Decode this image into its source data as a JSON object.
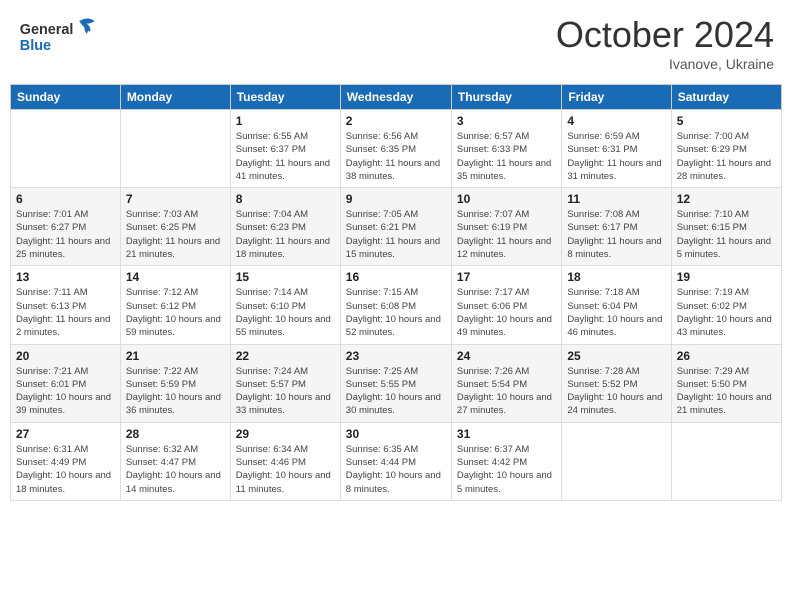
{
  "header": {
    "logo_line1": "General",
    "logo_line2": "Blue",
    "month": "October 2024",
    "location": "Ivanove, Ukraine"
  },
  "weekdays": [
    "Sunday",
    "Monday",
    "Tuesday",
    "Wednesday",
    "Thursday",
    "Friday",
    "Saturday"
  ],
  "weeks": [
    [
      {
        "day": "",
        "info": ""
      },
      {
        "day": "",
        "info": ""
      },
      {
        "day": "1",
        "info": "Sunrise: 6:55 AM\nSunset: 6:37 PM\nDaylight: 11 hours and 41 minutes."
      },
      {
        "day": "2",
        "info": "Sunrise: 6:56 AM\nSunset: 6:35 PM\nDaylight: 11 hours and 38 minutes."
      },
      {
        "day": "3",
        "info": "Sunrise: 6:57 AM\nSunset: 6:33 PM\nDaylight: 11 hours and 35 minutes."
      },
      {
        "day": "4",
        "info": "Sunrise: 6:59 AM\nSunset: 6:31 PM\nDaylight: 11 hours and 31 minutes."
      },
      {
        "day": "5",
        "info": "Sunrise: 7:00 AM\nSunset: 6:29 PM\nDaylight: 11 hours and 28 minutes."
      }
    ],
    [
      {
        "day": "6",
        "info": "Sunrise: 7:01 AM\nSunset: 6:27 PM\nDaylight: 11 hours and 25 minutes."
      },
      {
        "day": "7",
        "info": "Sunrise: 7:03 AM\nSunset: 6:25 PM\nDaylight: 11 hours and 21 minutes."
      },
      {
        "day": "8",
        "info": "Sunrise: 7:04 AM\nSunset: 6:23 PM\nDaylight: 11 hours and 18 minutes."
      },
      {
        "day": "9",
        "info": "Sunrise: 7:05 AM\nSunset: 6:21 PM\nDaylight: 11 hours and 15 minutes."
      },
      {
        "day": "10",
        "info": "Sunrise: 7:07 AM\nSunset: 6:19 PM\nDaylight: 11 hours and 12 minutes."
      },
      {
        "day": "11",
        "info": "Sunrise: 7:08 AM\nSunset: 6:17 PM\nDaylight: 11 hours and 8 minutes."
      },
      {
        "day": "12",
        "info": "Sunrise: 7:10 AM\nSunset: 6:15 PM\nDaylight: 11 hours and 5 minutes."
      }
    ],
    [
      {
        "day": "13",
        "info": "Sunrise: 7:11 AM\nSunset: 6:13 PM\nDaylight: 11 hours and 2 minutes."
      },
      {
        "day": "14",
        "info": "Sunrise: 7:12 AM\nSunset: 6:12 PM\nDaylight: 10 hours and 59 minutes."
      },
      {
        "day": "15",
        "info": "Sunrise: 7:14 AM\nSunset: 6:10 PM\nDaylight: 10 hours and 55 minutes."
      },
      {
        "day": "16",
        "info": "Sunrise: 7:15 AM\nSunset: 6:08 PM\nDaylight: 10 hours and 52 minutes."
      },
      {
        "day": "17",
        "info": "Sunrise: 7:17 AM\nSunset: 6:06 PM\nDaylight: 10 hours and 49 minutes."
      },
      {
        "day": "18",
        "info": "Sunrise: 7:18 AM\nSunset: 6:04 PM\nDaylight: 10 hours and 46 minutes."
      },
      {
        "day": "19",
        "info": "Sunrise: 7:19 AM\nSunset: 6:02 PM\nDaylight: 10 hours and 43 minutes."
      }
    ],
    [
      {
        "day": "20",
        "info": "Sunrise: 7:21 AM\nSunset: 6:01 PM\nDaylight: 10 hours and 39 minutes."
      },
      {
        "day": "21",
        "info": "Sunrise: 7:22 AM\nSunset: 5:59 PM\nDaylight: 10 hours and 36 minutes."
      },
      {
        "day": "22",
        "info": "Sunrise: 7:24 AM\nSunset: 5:57 PM\nDaylight: 10 hours and 33 minutes."
      },
      {
        "day": "23",
        "info": "Sunrise: 7:25 AM\nSunset: 5:55 PM\nDaylight: 10 hours and 30 minutes."
      },
      {
        "day": "24",
        "info": "Sunrise: 7:26 AM\nSunset: 5:54 PM\nDaylight: 10 hours and 27 minutes."
      },
      {
        "day": "25",
        "info": "Sunrise: 7:28 AM\nSunset: 5:52 PM\nDaylight: 10 hours and 24 minutes."
      },
      {
        "day": "26",
        "info": "Sunrise: 7:29 AM\nSunset: 5:50 PM\nDaylight: 10 hours and 21 minutes."
      }
    ],
    [
      {
        "day": "27",
        "info": "Sunrise: 6:31 AM\nSunset: 4:49 PM\nDaylight: 10 hours and 18 minutes."
      },
      {
        "day": "28",
        "info": "Sunrise: 6:32 AM\nSunset: 4:47 PM\nDaylight: 10 hours and 14 minutes."
      },
      {
        "day": "29",
        "info": "Sunrise: 6:34 AM\nSunset: 4:46 PM\nDaylight: 10 hours and 11 minutes."
      },
      {
        "day": "30",
        "info": "Sunrise: 6:35 AM\nSunset: 4:44 PM\nDaylight: 10 hours and 8 minutes."
      },
      {
        "day": "31",
        "info": "Sunrise: 6:37 AM\nSunset: 4:42 PM\nDaylight: 10 hours and 5 minutes."
      },
      {
        "day": "",
        "info": ""
      },
      {
        "day": "",
        "info": ""
      }
    ]
  ]
}
